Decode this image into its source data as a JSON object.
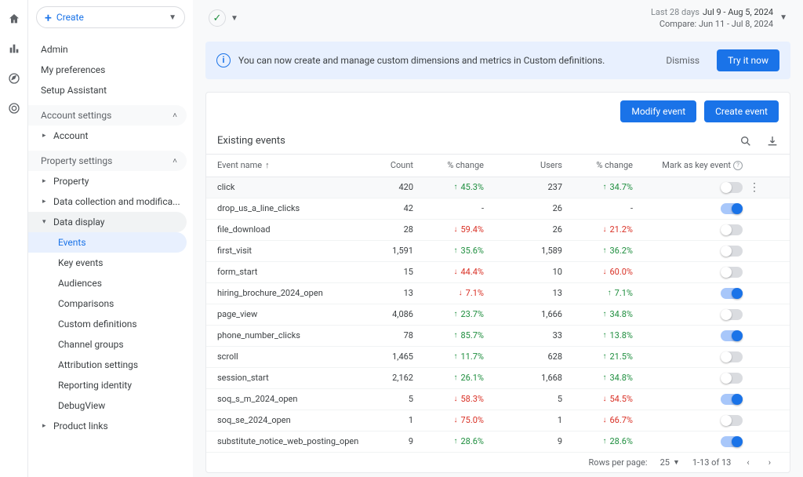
{
  "leftRail": {
    "icons": [
      "home",
      "bar-chart",
      "explore",
      "spiral"
    ]
  },
  "create": {
    "label": "Create"
  },
  "adminNav": [
    "Admin",
    "My preferences",
    "Setup Assistant"
  ],
  "sections": {
    "account": {
      "title": "Account settings",
      "items": [
        "Account"
      ]
    },
    "property": {
      "title": "Property settings",
      "items": [
        {
          "label": "Property",
          "expanded": false
        },
        {
          "label": "Data collection and modifica...",
          "expanded": false
        },
        {
          "label": "Data display",
          "expanded": true,
          "children": [
            "Events",
            "Key events",
            "Audiences",
            "Comparisons",
            "Custom definitions",
            "Channel groups",
            "Attribution settings",
            "Reporting identity",
            "DebugView"
          ],
          "selected": "Events"
        },
        {
          "label": "Product links",
          "expanded": false
        }
      ]
    }
  },
  "dateRange": {
    "label": "Last 28 days",
    "range": "Jul 9 - Aug 5, 2024",
    "compare": "Compare: Jun 11 - Jul 8, 2024"
  },
  "banner": {
    "text": "You can now create and manage custom dimensions and metrics in Custom definitions.",
    "dismiss": "Dismiss",
    "cta": "Try it now"
  },
  "actions": {
    "modify": "Modify event",
    "create": "Create event"
  },
  "table": {
    "title": "Existing events",
    "headers": {
      "name": "Event name",
      "count": "Count",
      "change1": "% change",
      "users": "Users",
      "change2": "% change",
      "key": "Mark as key event"
    },
    "rows": [
      {
        "name": "click",
        "count": "420",
        "c1": {
          "dir": "up",
          "v": "45.3%"
        },
        "users": "237",
        "c2": {
          "dir": "up",
          "v": "34.7%"
        },
        "key": false,
        "hov": true,
        "more": true
      },
      {
        "name": "drop_us_a_line_clicks",
        "count": "42",
        "c1": {
          "dir": "",
          "v": "-"
        },
        "users": "26",
        "c2": {
          "dir": "",
          "v": "-"
        },
        "key": true
      },
      {
        "name": "file_download",
        "count": "28",
        "c1": {
          "dir": "down",
          "v": "59.4%"
        },
        "users": "26",
        "c2": {
          "dir": "down",
          "v": "21.2%"
        },
        "key": false
      },
      {
        "name": "first_visit",
        "count": "1,591",
        "c1": {
          "dir": "up",
          "v": "35.6%"
        },
        "users": "1,589",
        "c2": {
          "dir": "up",
          "v": "36.2%"
        },
        "key": false
      },
      {
        "name": "form_start",
        "count": "15",
        "c1": {
          "dir": "down",
          "v": "44.4%"
        },
        "users": "10",
        "c2": {
          "dir": "down",
          "v": "60.0%"
        },
        "key": false
      },
      {
        "name": "hiring_brochure_2024_open",
        "count": "13",
        "c1": {
          "dir": "down",
          "v": "7.1%"
        },
        "users": "13",
        "c2": {
          "dir": "up",
          "v": "7.1%"
        },
        "key": true
      },
      {
        "name": "page_view",
        "count": "4,086",
        "c1": {
          "dir": "up",
          "v": "23.7%"
        },
        "users": "1,666",
        "c2": {
          "dir": "up",
          "v": "34.8%"
        },
        "key": false
      },
      {
        "name": "phone_number_clicks",
        "count": "78",
        "c1": {
          "dir": "up",
          "v": "85.7%"
        },
        "users": "33",
        "c2": {
          "dir": "up",
          "v": "13.8%"
        },
        "key": true
      },
      {
        "name": "scroll",
        "count": "1,465",
        "c1": {
          "dir": "up",
          "v": "11.7%"
        },
        "users": "628",
        "c2": {
          "dir": "up",
          "v": "21.5%"
        },
        "key": false
      },
      {
        "name": "session_start",
        "count": "2,162",
        "c1": {
          "dir": "up",
          "v": "26.1%"
        },
        "users": "1,668",
        "c2": {
          "dir": "up",
          "v": "34.8%"
        },
        "key": false
      },
      {
        "name": "soq_s_m_2024_open",
        "count": "5",
        "c1": {
          "dir": "down",
          "v": "58.3%"
        },
        "users": "5",
        "c2": {
          "dir": "down",
          "v": "54.5%"
        },
        "key": true
      },
      {
        "name": "soq_se_2024_open",
        "count": "1",
        "c1": {
          "dir": "down",
          "v": "75.0%"
        },
        "users": "1",
        "c2": {
          "dir": "down",
          "v": "66.7%"
        },
        "key": false
      },
      {
        "name": "substitute_notice_web_posting_open",
        "count": "9",
        "c1": {
          "dir": "up",
          "v": "28.6%"
        },
        "users": "9",
        "c2": {
          "dir": "up",
          "v": "28.6%"
        },
        "key": true
      }
    ]
  },
  "footer": {
    "rowsLabel": "Rows per page:",
    "rowsValue": "25",
    "rangeText": "1-13 of 13"
  }
}
